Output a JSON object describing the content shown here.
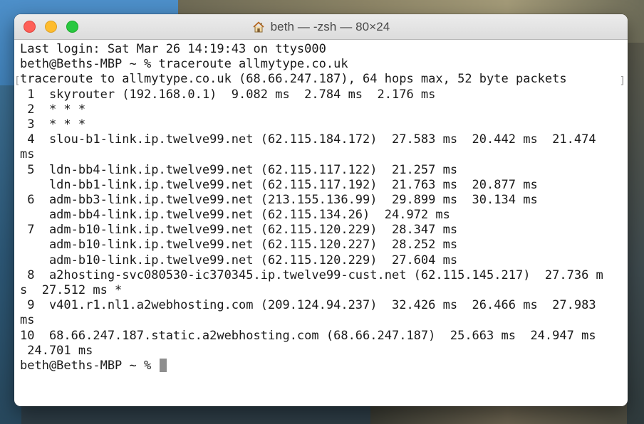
{
  "window": {
    "title": "beth — -zsh — 80×24"
  },
  "terminal": {
    "lines": [
      "Last login: Sat Mar 26 14:19:43 on ttys000",
      "beth@Beths-MBP ~ % traceroute allmytype.co.uk",
      "traceroute to allmytype.co.uk (68.66.247.187), 64 hops max, 52 byte packets",
      " 1  skyrouter (192.168.0.1)  9.082 ms  2.784 ms  2.176 ms",
      " 2  * * *",
      " 3  * * *",
      " 4  slou-b1-link.ip.twelve99.net (62.115.184.172)  27.583 ms  20.442 ms  21.474",
      "ms",
      " 5  ldn-bb4-link.ip.twelve99.net (62.115.117.122)  21.257 ms",
      "    ldn-bb1-link.ip.twelve99.net (62.115.117.192)  21.763 ms  20.877 ms",
      " 6  adm-bb3-link.ip.twelve99.net (213.155.136.99)  29.899 ms  30.134 ms",
      "    adm-bb4-link.ip.twelve99.net (62.115.134.26)  24.972 ms",
      " 7  adm-b10-link.ip.twelve99.net (62.115.120.229)  28.347 ms",
      "    adm-b10-link.ip.twelve99.net (62.115.120.227)  28.252 ms",
      "    adm-b10-link.ip.twelve99.net (62.115.120.229)  27.604 ms",
      " 8  a2hosting-svc080530-ic370345.ip.twelve99-cust.net (62.115.145.217)  27.736 m",
      "s  27.512 ms *",
      " 9  v401.r1.nl1.a2webhosting.com (209.124.94.237)  32.426 ms  26.466 ms  27.983",
      "ms",
      "10  68.66.247.187.static.a2webhosting.com (68.66.247.187)  25.663 ms  24.947 ms",
      " 24.701 ms"
    ],
    "prompt": "beth@Beths-MBP ~ % "
  },
  "colors": {
    "close": "#fe5f57",
    "minimize": "#febc2e",
    "maximize": "#28c840"
  },
  "icons": {
    "title_icon": "home-icon"
  }
}
